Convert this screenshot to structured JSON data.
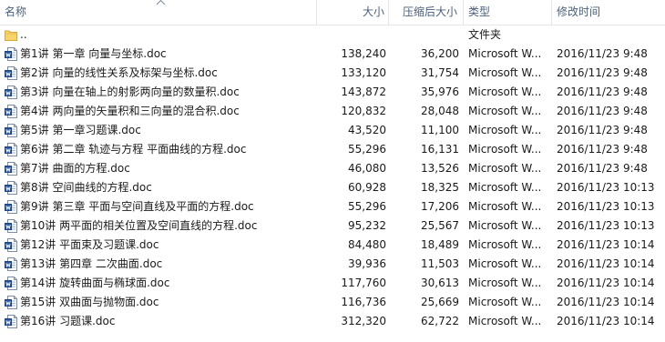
{
  "columns": {
    "name": "名称",
    "size": "大小",
    "compressed_size": "压缩后大小",
    "type": "类型",
    "modified": "修改时间"
  },
  "parent_folder": {
    "name": "..",
    "type": "文件夹"
  },
  "files": [
    {
      "name": "第1讲 第一章  向量与坐标.doc",
      "size": "138,240",
      "compressed": "36,200",
      "type": "Microsoft W...",
      "modified": "2016/11/23 9:48"
    },
    {
      "name": "第2讲 向量的线性关系及标架与坐标.doc",
      "size": "133,120",
      "compressed": "31,754",
      "type": "Microsoft W...",
      "modified": "2016/11/23 9:48"
    },
    {
      "name": "第3讲 向量在轴上的射影两向量的数量积.doc",
      "size": "143,872",
      "compressed": "35,976",
      "type": "Microsoft W...",
      "modified": "2016/11/23 9:48"
    },
    {
      "name": "第4讲 两向量的矢量积和三向量的混合积.doc",
      "size": "120,832",
      "compressed": "28,048",
      "type": "Microsoft W...",
      "modified": "2016/11/23 9:48"
    },
    {
      "name": "第5讲 第一章习题课.doc",
      "size": "43,520",
      "compressed": "11,100",
      "type": "Microsoft W...",
      "modified": "2016/11/23 9:48"
    },
    {
      "name": "第6讲 第二章 轨迹与方程 平面曲线的方程.doc",
      "size": "55,296",
      "compressed": "16,131",
      "type": "Microsoft W...",
      "modified": "2016/11/23 9:48"
    },
    {
      "name": "第7讲 曲面的方程.doc",
      "size": "46,080",
      "compressed": "13,526",
      "type": "Microsoft W...",
      "modified": "2016/11/23 9:48"
    },
    {
      "name": "第8讲 空间曲线的方程.doc",
      "size": "60,928",
      "compressed": "18,325",
      "type": "Microsoft W...",
      "modified": "2016/11/23 10:13"
    },
    {
      "name": "第9讲 第三章  平面与空间直线及平面的方程.doc",
      "size": "55,296",
      "compressed": "17,206",
      "type": "Microsoft W...",
      "modified": "2016/11/23 10:13"
    },
    {
      "name": "第10讲 两平面的相关位置及空间直线的方程.doc",
      "size": "95,232",
      "compressed": "25,567",
      "type": "Microsoft W...",
      "modified": "2016/11/23 10:13"
    },
    {
      "name": "第12讲 平面束及习题课.doc",
      "size": "84,480",
      "compressed": "18,489",
      "type": "Microsoft W...",
      "modified": "2016/11/23 10:14"
    },
    {
      "name": "第13讲 第四章  二次曲面.doc",
      "size": "39,936",
      "compressed": "11,503",
      "type": "Microsoft W...",
      "modified": "2016/11/23 10:14"
    },
    {
      "name": "第14讲 旋转曲面与椭球面.doc",
      "size": "117,760",
      "compressed": "30,613",
      "type": "Microsoft W...",
      "modified": "2016/11/23 10:14"
    },
    {
      "name": "第15讲 双曲面与抛物面.doc",
      "size": "116,736",
      "compressed": "25,669",
      "type": "Microsoft W...",
      "modified": "2016/11/23 10:14"
    },
    {
      "name": "第16讲 习题课.doc",
      "size": "312,320",
      "compressed": "62,722",
      "type": "Microsoft W...",
      "modified": "2016/11/23 10:14"
    }
  ],
  "icons": {
    "folder": "folder-up-icon",
    "file": "word-document-icon",
    "sort": "sort-ascending-icon"
  },
  "colors": {
    "header_text": "#4c607a",
    "folder_yellow": "#f6d36b",
    "word_blue": "#2b579a"
  }
}
